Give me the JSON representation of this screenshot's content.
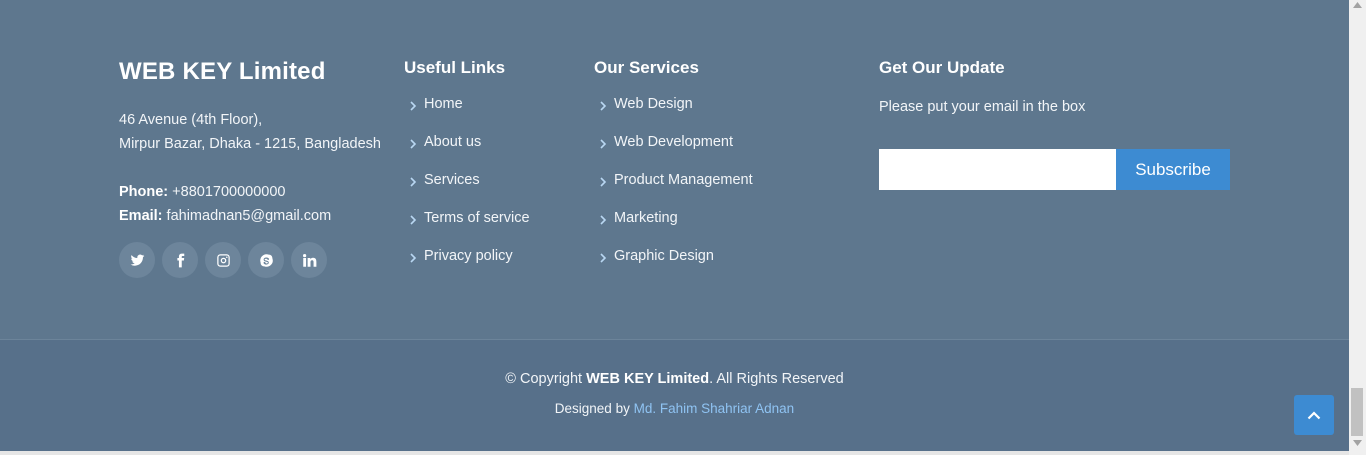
{
  "brand": {
    "name": "WEB KEY Limited",
    "address_line1": "46 Avenue (4th Floor),",
    "address_line2": "Mirpur Bazar, Dhaka - 1215, Bangladesh",
    "phone_label": "Phone:",
    "phone_value": "+8801700000000",
    "email_label": "Email:",
    "email_value": "fahimadnan5@gmail.com"
  },
  "social": [
    "twitter-icon",
    "facebook-icon",
    "instagram-icon",
    "skype-icon",
    "linkedin-icon"
  ],
  "useful_links": {
    "heading": "Useful Links",
    "items": [
      "Home",
      "About us",
      "Services",
      "Terms of service",
      "Privacy policy"
    ]
  },
  "services": {
    "heading": "Our Services",
    "items": [
      "Web Design",
      "Web Development",
      "Product Management",
      "Marketing",
      "Graphic Design"
    ]
  },
  "newsletter": {
    "heading": "Get Our Update",
    "text": "Please put your email in the box",
    "input_value": "",
    "button_label": "Subscribe"
  },
  "copyright": {
    "prefix": "© Copyright",
    "company": "WEB KEY Limited",
    "suffix": ". All Rights Reserved",
    "designed_by": "Designed by",
    "designer": "Md. Fahim Shahriar Adnan"
  },
  "colors": {
    "footer_bg": "#5e778e",
    "bottom_bg": "#57708a",
    "accent": "#3d8bd2",
    "link": "#8fc3f2"
  }
}
